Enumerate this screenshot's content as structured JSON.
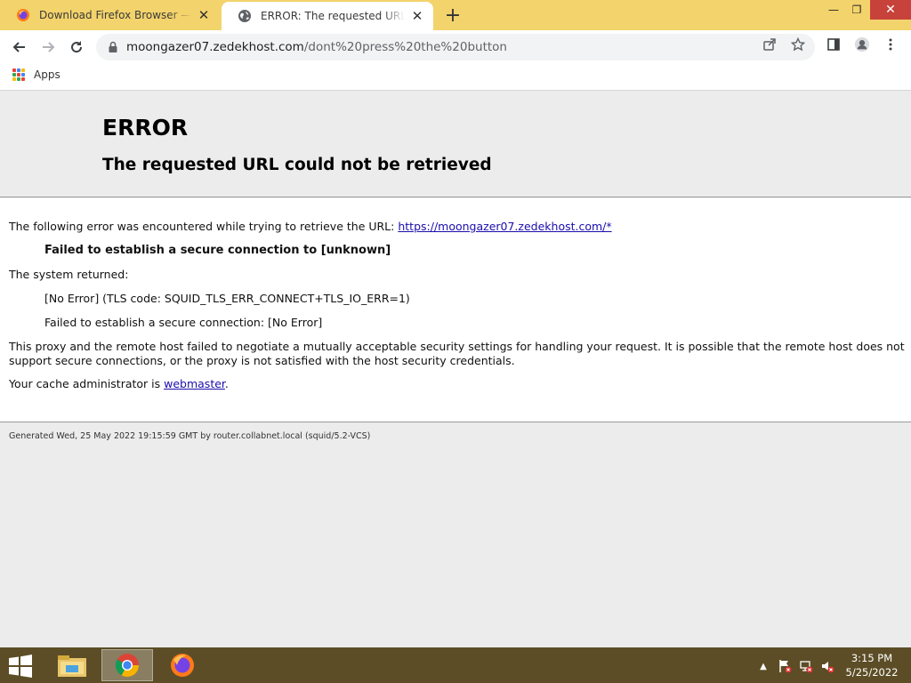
{
  "browser": {
    "tabs": [
      {
        "title": "Download Firefox Browser — Fast",
        "active": false
      },
      {
        "title": "ERROR: The requested URL could not be retrieved",
        "active": true
      }
    ],
    "new_tab_label": "+",
    "window_controls": {
      "minimize": "—",
      "restore": "❐",
      "close": "✕"
    },
    "address": {
      "host": "moongazer07.zedekhost.com",
      "path": "/dont%20press%20the%20button"
    },
    "bookmarks": [
      {
        "label": "Apps",
        "icon": "apps-grid-icon"
      }
    ]
  },
  "page": {
    "heading": "ERROR",
    "subheading": "The requested URL could not be retrieved",
    "intro_text": "The following error was encountered while trying to retrieve the URL: ",
    "intro_link": "https://moongazer07.zedekhost.com/*",
    "error_title": "Failed to establish a secure connection to [unknown]",
    "system_returned_label": "The system returned:",
    "system_line_1": "[No Error] (TLS code: SQUID_TLS_ERR_CONNECT+TLS_IO_ERR=1)",
    "system_line_2": "Failed to establish a secure connection: [No Error]",
    "explanation_line_1": "This proxy and the remote host failed to negotiate a mutually acceptable security settings for handling your request. It is possible that the remote host does not",
    "explanation_line_2": "support secure connections, or the proxy is not satisfied with the host security credentials.",
    "admin_prefix": "Your cache administrator is ",
    "admin_link": "webmaster",
    "admin_suffix": ".",
    "footer": "Generated Wed, 25 May 2022 19:15:59 GMT by router.collabnet.local (squid/5.2-VCS)"
  },
  "taskbar": {
    "apps": [
      "file-explorer-icon",
      "chrome-icon",
      "firefox-icon"
    ],
    "active_app": "chrome-icon",
    "clock_time": "3:15 PM",
    "clock_date": "5/25/2022"
  },
  "colors": {
    "tabstrip": "#f3d36b",
    "taskbar": "#5c4d26",
    "link": "#1a0dab",
    "close_button": "#c7423a"
  }
}
